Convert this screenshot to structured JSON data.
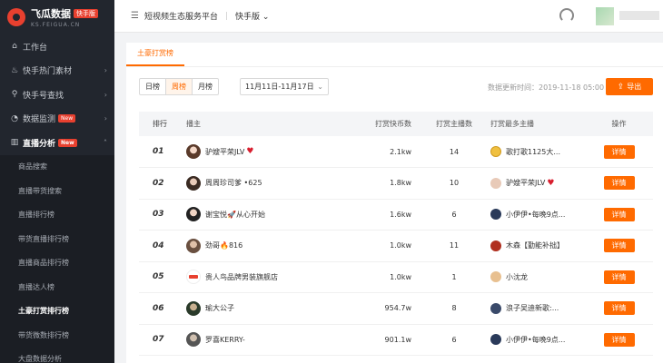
{
  "brand": {
    "title": "飞瓜数据",
    "badge": "快手版",
    "subtitle": "KS.FEIGUA.CN"
  },
  "sidebar": {
    "items": [
      {
        "label": "工作台",
        "icon": "home-icon",
        "glyph": "⌂"
      },
      {
        "label": "快手热门素材",
        "icon": "flame-icon",
        "glyph": "♨",
        "caret": "›"
      },
      {
        "label": "快手号查找",
        "icon": "search-icon",
        "glyph": "⚲",
        "caret": "›"
      },
      {
        "label": "数据监测",
        "icon": "monitor-icon",
        "glyph": "◔",
        "caret": "›",
        "badge": "New"
      },
      {
        "label": "直播分析",
        "icon": "live-chart-icon",
        "glyph": "▥",
        "caret": "˄",
        "badge": "New"
      }
    ],
    "sub_items": [
      "商品搜索",
      "直播带货搜索",
      "直播排行榜",
      "带货直播排行榜",
      "直播商品排行榜",
      "直播达人榜",
      "土豪打赏排行榜",
      "带货微数排行榜",
      "大盘数据分析"
    ],
    "active_sub": "土豪打赏排行榜"
  },
  "topbar": {
    "menu_glyph": "☰",
    "platform": "短视频生态服务平台",
    "separator": "|",
    "version": "快手版",
    "version_caret": "⌄"
  },
  "main": {
    "tab": "土豪打赏榜",
    "periods": [
      "日榜",
      "周榜",
      "月榜"
    ],
    "active_period": "周榜",
    "date_range": "11月11日-11月17日",
    "date_caret": "⌄",
    "update_time": "数据更新时间：2019-11-18 05:00",
    "export_label": "导出",
    "export_glyph": "⇪"
  },
  "table": {
    "headers": {
      "rank": "排行",
      "anchor": "播主",
      "coins": "打赏快币数",
      "count": "打赏主播数",
      "top": "打赏最多主播",
      "op": "操作"
    },
    "detail_label": "详情",
    "rows": [
      {
        "rank": "01",
        "anchor": "驴嫂平荣JLV",
        "anchor_heart": "♥",
        "coins": "2.1kw",
        "count": "14",
        "top": "歌打歌1125大...",
        "top_heart": ""
      },
      {
        "rank": "02",
        "anchor": "周周珍司爹 •625",
        "anchor_heart": "",
        "coins": "1.8kw",
        "count": "10",
        "top": "驴嫂平荣JLV",
        "top_heart": "♥"
      },
      {
        "rank": "03",
        "anchor": "谢宝悦🚀从心开始",
        "anchor_heart": "",
        "coins": "1.6kw",
        "count": "6",
        "top": "小伊伊•每晚9点...",
        "top_heart": ""
      },
      {
        "rank": "04",
        "anchor": "劲哥🔥816",
        "anchor_heart": "",
        "coins": "1.0kw",
        "count": "11",
        "top": "木森【勤能补拙】",
        "top_heart": ""
      },
      {
        "rank": "05",
        "anchor": "贵人鸟品牌男装旗舰店",
        "anchor_heart": "",
        "coins": "1.0kw",
        "count": "1",
        "top": "小沈龙",
        "top_heart": ""
      },
      {
        "rank": "06",
        "anchor": "瑜大公子",
        "anchor_heart": "",
        "coins": "954.7w",
        "count": "8",
        "top": "浪子吴迪新歌:...",
        "top_heart": ""
      },
      {
        "rank": "07",
        "anchor": "罗喜KERRY-",
        "anchor_heart": "",
        "coins": "901.1w",
        "count": "6",
        "top": "小伊伊•每晚9点...",
        "top_heart": ""
      }
    ]
  },
  "colors": {
    "accent": "#ff6a00",
    "sidebar_bg": "#22262e",
    "new_badge": "#e8402f"
  }
}
